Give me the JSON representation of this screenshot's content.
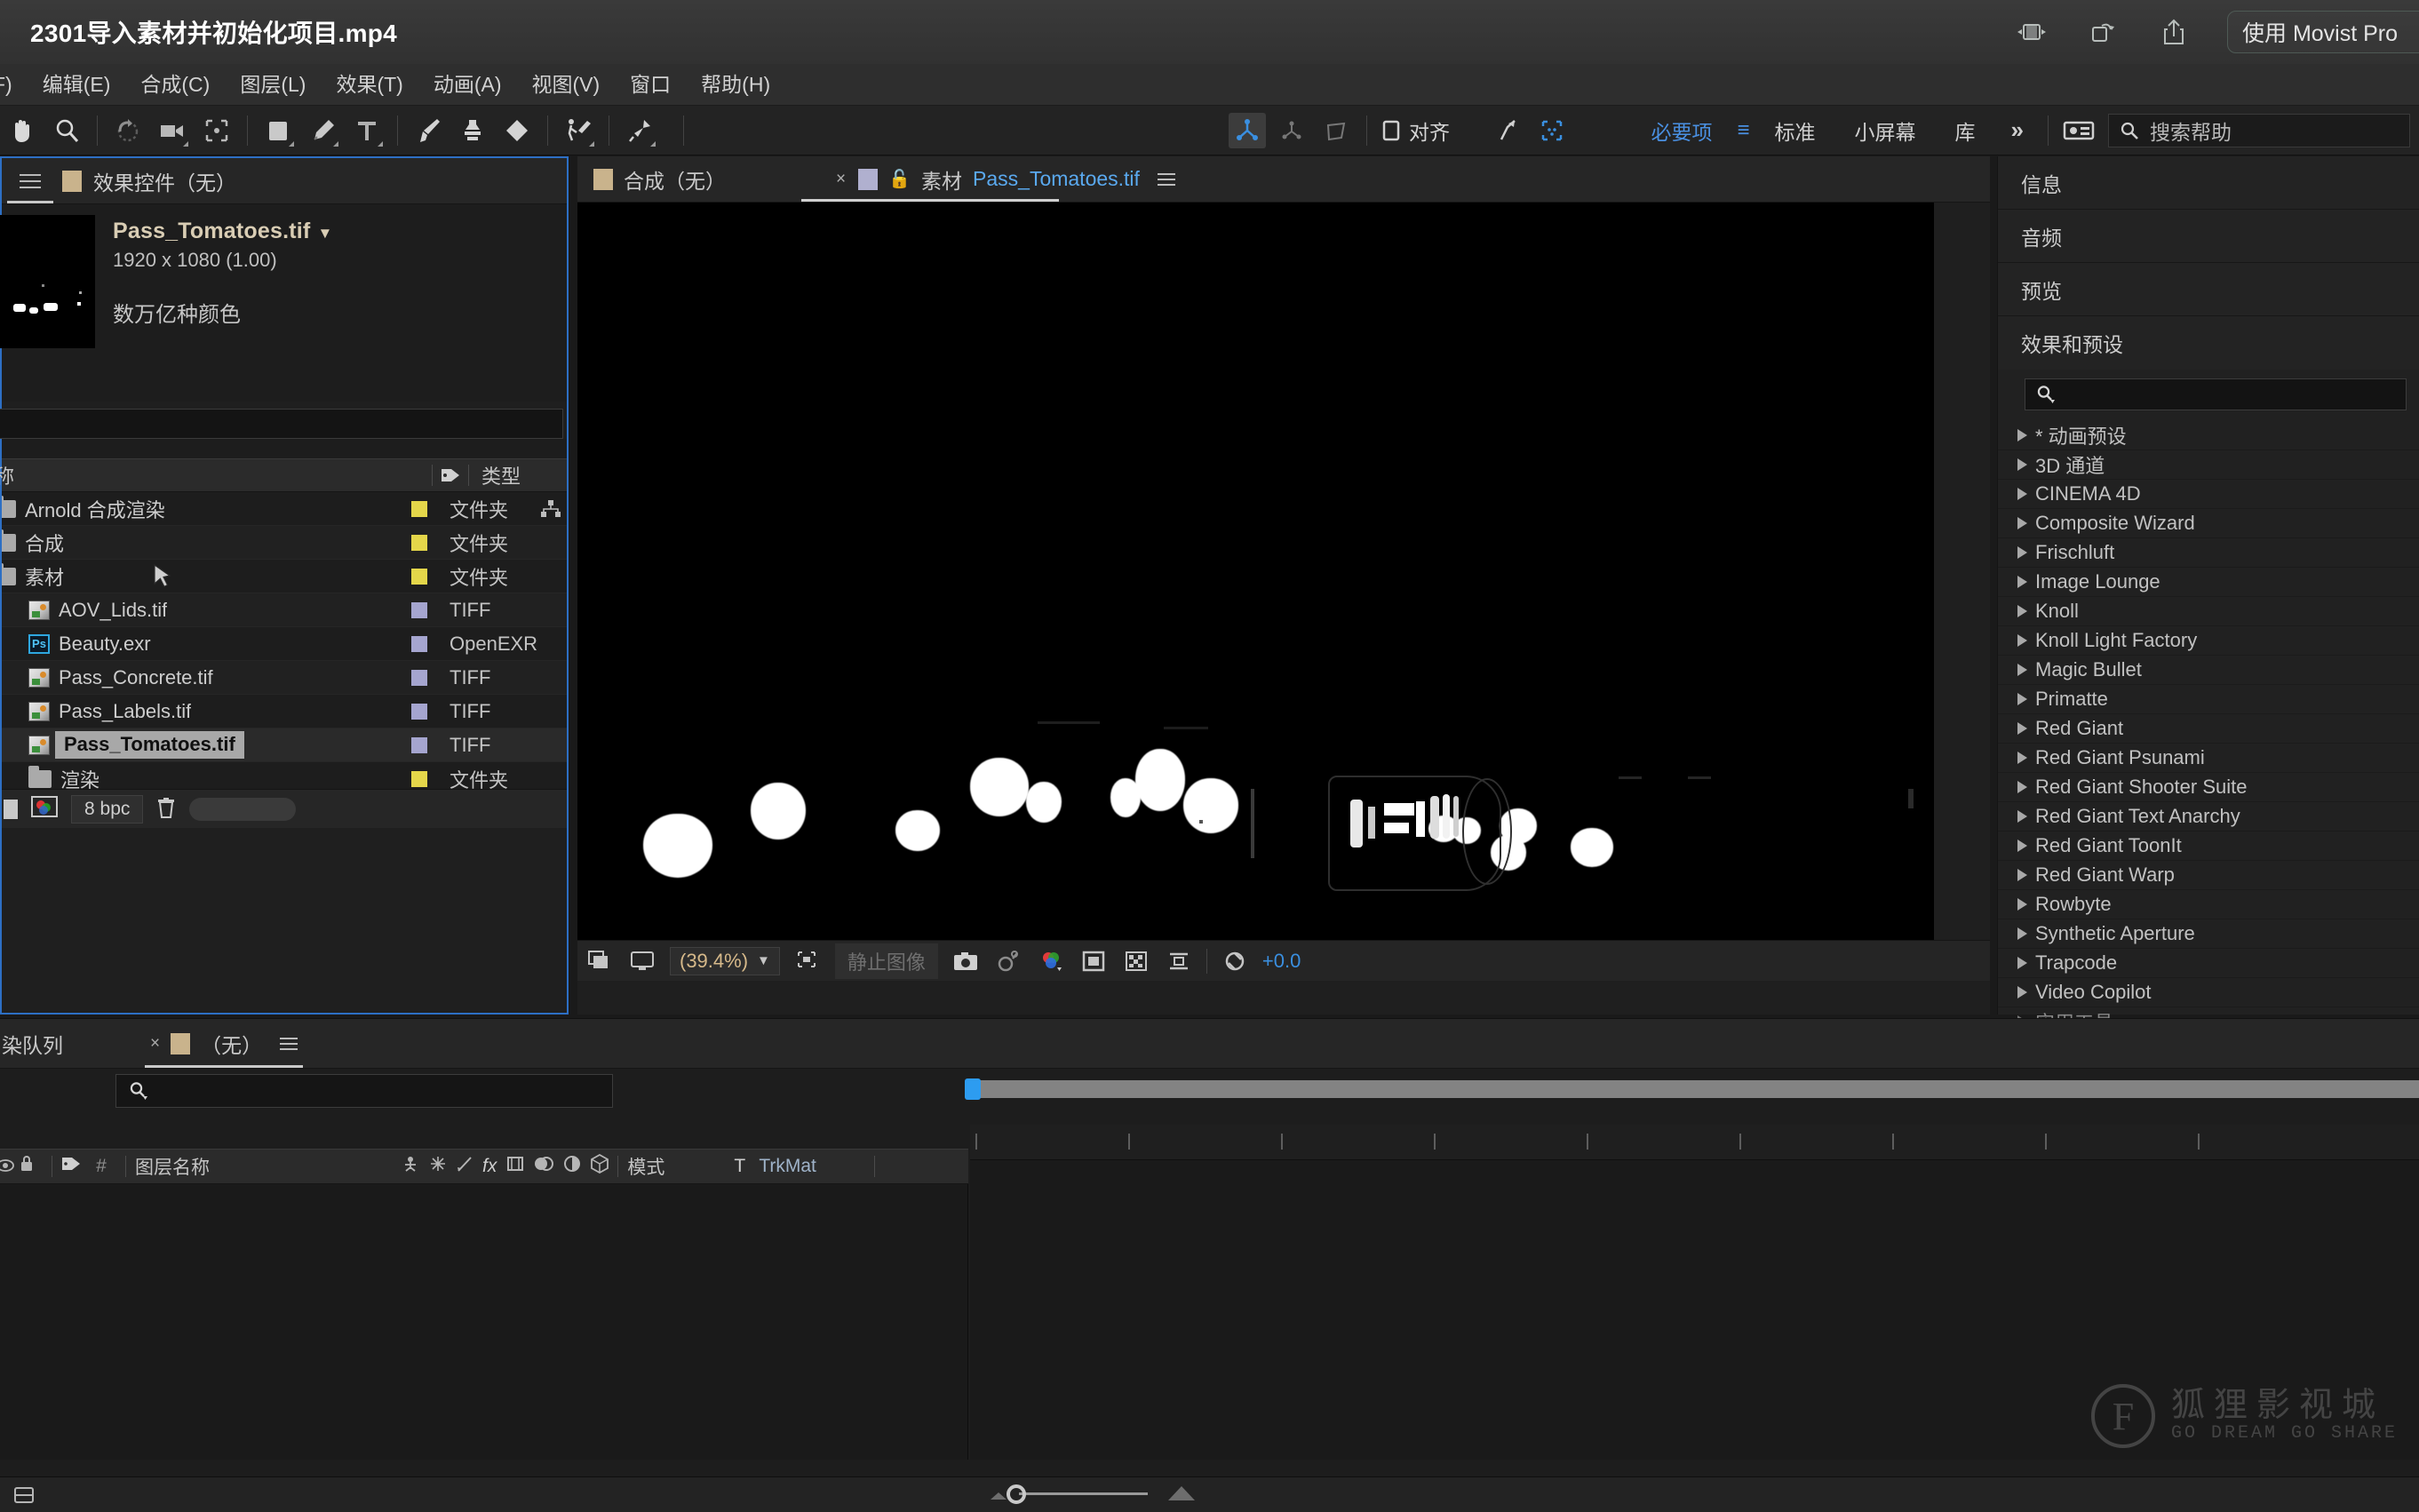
{
  "titlebar": {
    "title": "2301导入素材并初始化项目.mp4",
    "icons": [
      "pip-icon",
      "rotate-icon",
      "share-icon"
    ],
    "movist_label": "使用 Movist Pro"
  },
  "menubar": {
    "items": [
      "F)",
      "编辑(E)",
      "合成(C)",
      "图层(L)",
      "效果(T)",
      "动画(A)",
      "视图(V)",
      "窗口",
      "帮助(H)"
    ]
  },
  "toolbar": {
    "tools": [
      {
        "name": "hand-tool",
        "selected": false
      },
      {
        "name": "zoom-tool",
        "selected": false
      },
      {
        "name": "rotate-tool",
        "selected": false
      },
      {
        "name": "camera-tool",
        "selected": false
      },
      {
        "name": "anchor-point-tool",
        "selected": false
      },
      {
        "name": "shape-tool",
        "selected": false
      },
      {
        "name": "pen-tool",
        "selected": false
      },
      {
        "name": "type-tool",
        "selected": false
      },
      {
        "name": "brush-tool",
        "selected": false
      },
      {
        "name": "clone-stamp-tool",
        "selected": false
      },
      {
        "name": "eraser-tool",
        "selected": false
      },
      {
        "name": "roto-brush-tool",
        "selected": false
      },
      {
        "name": "puppet-pin-tool",
        "selected": false
      }
    ],
    "axis_tools": [
      "local-axis-icon",
      "world-axis-icon",
      "view-axis-icon"
    ],
    "align_label": "对齐",
    "snap_tools": [
      "snapping-icon",
      "transform-box-icon"
    ],
    "workspaces": [
      {
        "label": "必要项",
        "active": true
      },
      {
        "label": "标准",
        "active": false
      },
      {
        "label": "小屏幕",
        "active": false
      },
      {
        "label": "库",
        "active": false
      }
    ],
    "overflow": "»",
    "search_placeholder": "搜索帮助"
  },
  "effect_controls": {
    "tab_label": "效果控件（无）",
    "item_name": "Pass_Tomatoes.tif",
    "dimensions": "1920 x 1080 (1.00)",
    "color_depth": "数万亿种颜色"
  },
  "project": {
    "columns": [
      "称",
      "tag-icon",
      "类型"
    ],
    "rows": [
      {
        "name": "Arnold 合成渲染",
        "icon": "folder-icon",
        "swatch": "#e4d64a",
        "type": "文件夹",
        "selected": false,
        "extra": "hierarchy-icon"
      },
      {
        "name": "合成",
        "icon": "folder-icon",
        "swatch": "#e4d64a",
        "type": "文件夹",
        "selected": false,
        "extra": ""
      },
      {
        "name": "素材",
        "icon": "folder-icon",
        "swatch": "#e4d64a",
        "type": "文件夹",
        "selected": false,
        "extra": ""
      },
      {
        "name": "AOV_Lids.tif",
        "icon": "tiff-icon",
        "swatch": "#a5a5cf",
        "type": "TIFF",
        "selected": false,
        "extra": ""
      },
      {
        "name": "Beauty.exr",
        "icon": "photoshop-icon",
        "swatch": "#a5a5cf",
        "type": "OpenEXR",
        "selected": false,
        "extra": ""
      },
      {
        "name": "Pass_Concrete.tif",
        "icon": "tiff-icon",
        "swatch": "#a5a5cf",
        "type": "TIFF",
        "selected": false,
        "extra": ""
      },
      {
        "name": "Pass_Labels.tif",
        "icon": "tiff-icon",
        "swatch": "#a5a5cf",
        "type": "TIFF",
        "selected": false,
        "extra": ""
      },
      {
        "name": "Pass_Tomatoes.tif",
        "icon": "tiff-icon",
        "swatch": "#a5a5cf",
        "type": "TIFF",
        "selected": true,
        "extra": ""
      },
      {
        "name": "渲染",
        "icon": "folder-icon",
        "swatch": "#e4d64a",
        "type": "文件夹",
        "selected": false,
        "extra": ""
      }
    ],
    "footer": {
      "bit_depth": "8 bpc"
    }
  },
  "viewer": {
    "tab_comp": "合成（无）",
    "tab_footage_prefix": "素材",
    "tab_footage_name": "Pass_Tomatoes.tif",
    "close_x": "×",
    "zoom_level": "(39.4%)",
    "still_label": "静止图像",
    "exposure": "+0.0",
    "bottom_icons": [
      "render-quality-icon",
      "view-layout-icon",
      "region-of-interest-icon",
      "snapshot-icon",
      "show-snapshot-icon",
      "channel-icon",
      "mask-icon",
      "transparency-grid-icon",
      "guides-icon",
      "exposure-reset-icon"
    ]
  },
  "right_panel": {
    "tabs": [
      "信息",
      "音频",
      "预览"
    ],
    "effects_title": "效果和预设",
    "search_placeholder": "",
    "effects": [
      "* 动画预设",
      "3D 通道",
      "CINEMA 4D",
      "Composite Wizard",
      "Frischluft",
      "Image Lounge",
      "Knoll",
      "Knoll Light Factory",
      "Magic Bullet",
      "Primatte",
      "Red Giant",
      "Red Giant Psunami",
      "Red Giant Shooter Suite",
      "Red Giant Text Anarchy",
      "Red Giant ToonIt",
      "Red Giant Warp",
      "Rowbyte",
      "Synthetic Aperture",
      "Trapcode",
      "Video Copilot",
      "实用工具"
    ]
  },
  "timeline": {
    "tab_render_queue": "染队列",
    "tab_comp": "（无）",
    "close_x": "×",
    "search_placeholder": "",
    "columns": {
      "eye": "eye-icon",
      "lock": "lock-icon",
      "tag": "tag-icon",
      "hash": "#",
      "layer_name": "图层名称",
      "switches": [
        "shy-icon",
        "collapse-icon",
        "quality-icon",
        "effects-fx-icon",
        "frame-blend-icon",
        "motion-blur-icon",
        "adjustment-icon",
        "3d-layer-icon"
      ],
      "mode": "模式",
      "t": "T",
      "trkmat": "TrkMat"
    },
    "ruler_ticks": 9
  },
  "watermark": {
    "letter": "F",
    "cn": "狐狸影视城",
    "en": "GO DREAM GO SHARE"
  }
}
